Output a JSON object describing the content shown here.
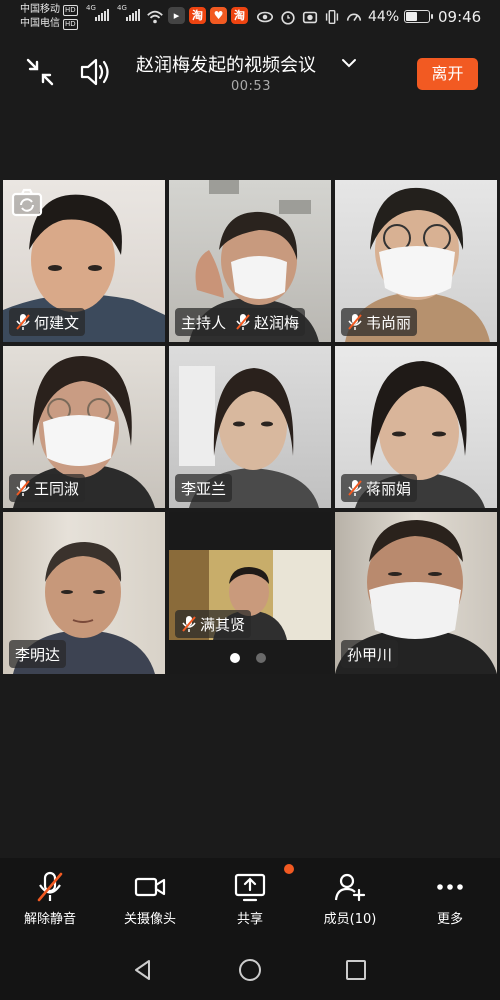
{
  "status_bar": {
    "carrier_1": "中国移动",
    "carrier_2": "中国电信",
    "hd_badge": "HD",
    "network": "4G",
    "battery": "44%",
    "battery_level": 0.44,
    "time": "09:46",
    "app_badges": [
      "淘",
      "淘"
    ]
  },
  "header": {
    "title": "赵润梅发起的视频会议",
    "timer": "00:53",
    "leave_label": "离开",
    "accent_color": "#f25a22"
  },
  "participants": [
    {
      "name": "何建文",
      "muted": true
    },
    {
      "name": "主持人",
      "name_2": "赵润梅",
      "muted": true
    },
    {
      "name": "韦尚丽",
      "muted": true
    },
    {
      "name": "王同淑",
      "muted": true
    },
    {
      "name": "李亚兰",
      "muted": false
    },
    {
      "name": "蒋丽娟",
      "muted": true
    },
    {
      "name": "李明达",
      "muted": false
    },
    {
      "name": "满其贤",
      "muted": true
    },
    {
      "name": "孙甲川",
      "muted": false
    }
  ],
  "pagination": {
    "pages": 2,
    "current": 1
  },
  "toolbar": {
    "unmute": "解除静音",
    "camera_off": "关摄像头",
    "share": "共享",
    "members": "成员(10)",
    "more": "更多"
  },
  "icons": [
    "minimize-icon",
    "speaker-icon",
    "chevron-down-icon",
    "camera-switch-icon",
    "mic-off-icon",
    "camera-icon",
    "share-screen-icon",
    "add-member-icon",
    "more-icon",
    "back-icon",
    "home-icon",
    "recents-icon"
  ]
}
